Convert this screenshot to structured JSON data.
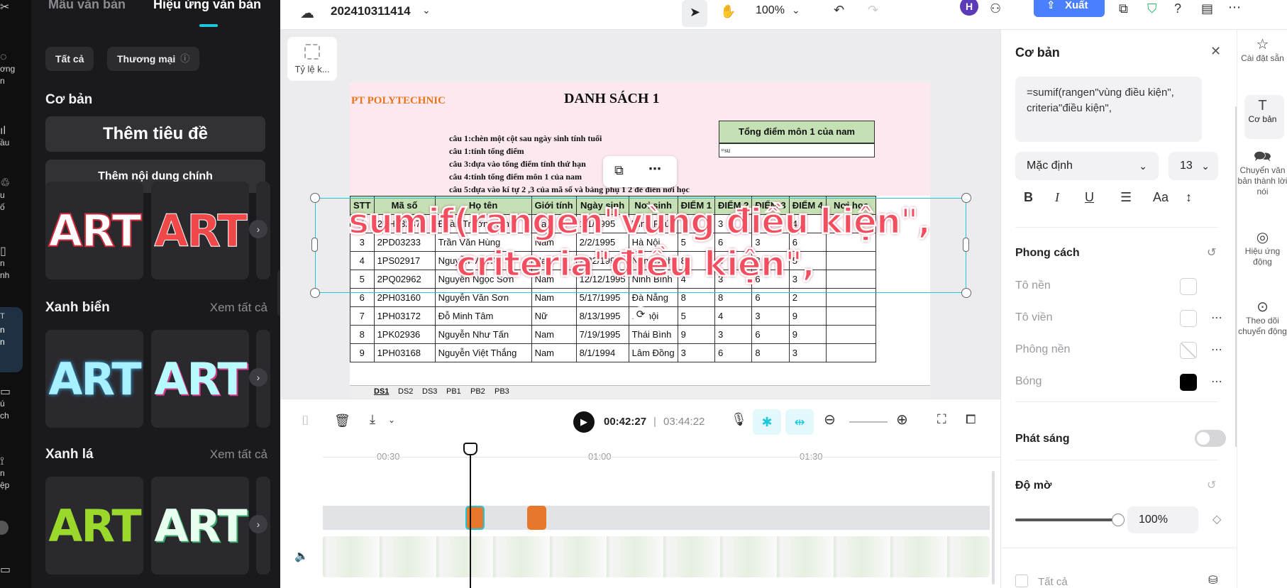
{
  "sidebar": {
    "items": [
      {
        "label": "ơng",
        "label2": "n"
      },
      {
        "label": "ầu",
        "label2": ""
      },
      {
        "label": "u",
        "label2": "ố"
      },
      {
        "label": "n",
        "label2": "nh"
      },
      {
        "label": "n",
        "label2": "n"
      },
      {
        "label": "ú",
        "label2": "ch"
      },
      {
        "label": "n",
        "label2": "ệp"
      }
    ]
  },
  "text_panel": {
    "tab_templates": "Mẫu văn bản",
    "tab_effects": "Hiệu ứng văn bản",
    "filter_all": "Tất cả",
    "filter_commercial": "Thương mại",
    "section_basic": "Cơ bản",
    "add_title": "Thêm tiêu đề",
    "add_body": "Thêm nội dung chính",
    "section_blue": "Xanh biển",
    "section_green": "Xanh lá",
    "see_all": "Xem tất cả",
    "art_label": "ART"
  },
  "topbar": {
    "project_name": "202410311414",
    "zoom": "100%",
    "avatar_letter": "H",
    "export_label": "Xuất"
  },
  "preview": {
    "ratio_label": "Tỷ lệ k...",
    "overlay_text_line1": "sumif(rangen\"vùng điều kiện\",",
    "overlay_text_line2": "criteria\"điều kiện\","
  },
  "sheet": {
    "brand": "PT POLYTECHNIC",
    "title": "DANH SÁCH 1",
    "notes": [
      "câu 1:chèn một cột sau ngày sinh tính tuổi",
      "câu 1:tính tổng điểm",
      "câu 3:dựa vào tổng điểm tính thứ hạn",
      "câu 4:tính tổng điểm môn 1 của nam",
      "câu 5:dựa vào kí tự 2 ,3 của mã số và bảng phụ 1 2 để điền nơi học"
    ],
    "box_title": "Tổng điểm môn 1 của nam",
    "box_value": "=su",
    "headers": [
      "STT",
      "Mã số",
      "Họ tên",
      "Giới tính",
      "Ngày sinh",
      "Nơi sinh",
      "ĐIỂM 1",
      "ĐIỂM 2",
      "ĐIỂM 3",
      "ĐIỂM 4",
      "Nơi học"
    ],
    "rows": [
      [
        "2",
        "2PH03237",
        "Đoàn Trường Sinh",
        "Nam",
        "1/1/1995",
        "Vĩnh Phúc",
        "7",
        "3",
        "7",
        "4",
        ""
      ],
      [
        "3",
        "2PD03233",
        "Trần Văn Hùng",
        "Nam",
        "2/2/1995",
        "Hà Nội",
        "5",
        "6",
        "3",
        "6",
        ""
      ],
      [
        "4",
        "1PS02917",
        "Nguyễn Văn An",
        "Nam",
        "2/22/1995",
        "Nam Định",
        "8",
        "6",
        "8",
        "5",
        ""
      ],
      [
        "5",
        "2PQ02962",
        "Nguyễn Ngọc Sơn",
        "Nam",
        "12/12/1995",
        "Ninh Bình",
        "4",
        "3",
        "6",
        "3",
        ""
      ],
      [
        "6",
        "2PH03160",
        "Nguyễn Văn Sơn",
        "Nam",
        "5/17/1995",
        "Đà Nẵng",
        "8",
        "8",
        "6",
        "2",
        ""
      ],
      [
        "7",
        "1PH03172",
        "Đỗ Minh Tâm",
        "Nữ",
        "8/13/1995",
        "Hà nội",
        "5",
        "4",
        "3",
        "9",
        ""
      ],
      [
        "8",
        "1PK02936",
        "Nguyễn Như Tấn",
        "Nam",
        "7/19/1995",
        "Thái Bình",
        "9",
        "3",
        "6",
        "9",
        ""
      ],
      [
        "9",
        "1PH03168",
        "Nguyễn Việt Thắng",
        "Nam",
        "8/1/1994",
        "Lâm Đồng",
        "3",
        "6",
        "8",
        "3",
        ""
      ]
    ],
    "sheet_tabs": [
      "DS1",
      "DS2",
      "DS3",
      "PB1",
      "PB2",
      "PB3"
    ]
  },
  "player": {
    "current_time": "00:42:27",
    "total_time": "03:44:22"
  },
  "timeline": {
    "ticks": [
      "00:30",
      "01:00",
      "01:30"
    ]
  },
  "properties": {
    "title": "Cơ bản",
    "text_value": "=sumif(rangen\"vùng điều kiện\", criteria\"điều kiện\",",
    "font": "Mặc định",
    "font_size": "13",
    "style_heading": "Phong cách",
    "fill": "Tô nền",
    "stroke": "Tô viền",
    "background": "Phông nền",
    "shadow": "Bóng",
    "glow": "Phát sáng",
    "opacity": "Độ mờ",
    "opacity_value": "100%",
    "opacity_level": 1.0,
    "apply_all": "Tất cả"
  },
  "rail": {
    "presets": "Cài đặt sẵn",
    "basic": "Cơ bản",
    "tts": "Chuyển văn bản thành lời nói",
    "animation": "Hiệu ứng động",
    "tracking": "Theo dõi chuyển động"
  }
}
